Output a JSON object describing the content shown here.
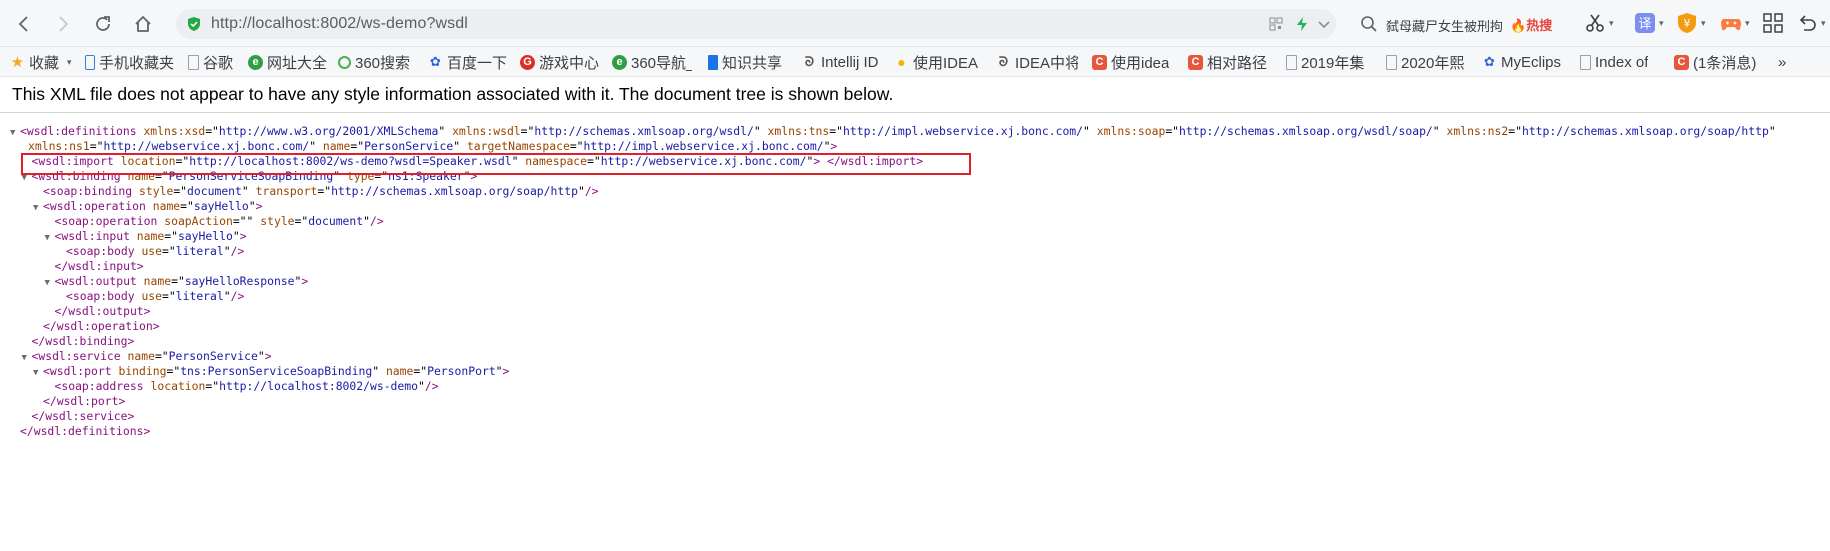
{
  "browser": {
    "url": "http://localhost:8002/ws-demo?wsdl",
    "search_hot_text": "弑母藏尸女生被刑拘",
    "search_hot_badge": "热搜"
  },
  "bookmarks": [
    {
      "label": "收藏",
      "icon": "star-icon",
      "color": "#f5a623"
    },
    {
      "label": "手机收藏夹",
      "icon": "phone-icon",
      "color": "#3a7bd5"
    },
    {
      "label": "谷歌",
      "icon": "page-icon",
      "color": "#9aa0a6"
    },
    {
      "label": "网址大全",
      "icon": "web-icon",
      "color": "#2f9e44"
    },
    {
      "label": "360搜索",
      "icon": "search-360-icon",
      "color": "#4caf50"
    },
    {
      "label": "百度一下",
      "icon": "baidu-paw-icon",
      "color": "#2b63d9"
    },
    {
      "label": "游戏中心",
      "icon": "game-icon",
      "color": "#d93025"
    },
    {
      "label": "360导航_",
      "icon": "nav-360-icon",
      "color": "#2f9e44"
    },
    {
      "label": "知识共享",
      "icon": "bookmark-blue-icon",
      "color": "#1a73e8"
    },
    {
      "label": "Intellij ID",
      "icon": "idea-icon",
      "color": "#555555"
    },
    {
      "label": "使用IDEA",
      "icon": "bulb-icon",
      "color": "#f4b400"
    },
    {
      "label": "IDEA中将",
      "icon": "idea-icon",
      "color": "#555555"
    },
    {
      "label": "使用idea",
      "icon": "csdn-icon",
      "color": "#e8553c"
    },
    {
      "label": "相对路径,",
      "icon": "csdn-icon",
      "color": "#e8553c"
    },
    {
      "label": "2019年集",
      "icon": "page-icon",
      "color": "#9aa0a6"
    },
    {
      "label": "2020年熙",
      "icon": "page-icon",
      "color": "#9aa0a6"
    },
    {
      "label": "MyEclips",
      "icon": "baidu-paw-icon",
      "color": "#2b63d9"
    },
    {
      "label": "Index of",
      "icon": "page-icon",
      "color": "#9aa0a6"
    },
    {
      "label": "(1条消息)",
      "icon": "csdn-icon",
      "color": "#e8553c"
    }
  ],
  "bookmarks_more": "»",
  "page": {
    "info": "This XML file does not appear to have any style information associated with it. The document tree is shown below."
  },
  "xml": {
    "definitions_open": {
      "tag": "wsdl:definitions",
      "attrs": [
        {
          "n": "xmlns:xsd",
          "v": "http://www.w3.org/2001/XMLSchema"
        },
        {
          "n": "xmlns:wsdl",
          "v": "http://schemas.xmlsoap.org/wsdl/"
        },
        {
          "n": "xmlns:tns",
          "v": "http://impl.webservice.xj.bonc.com/"
        },
        {
          "n": "xmlns:soap",
          "v": "http://schemas.xmlsoap.org/wsdl/soap/"
        },
        {
          "n": "xmlns:ns2",
          "v": "http://schemas.xmlsoap.org/soap/http"
        }
      ]
    },
    "definitions_cont": [
      {
        "n": "xmlns:ns1",
        "v": "http://webservice.xj.bonc.com/"
      },
      {
        "n": "name",
        "v": "PersonService"
      },
      {
        "n": "targetNamespace",
        "v": "http://impl.webservice.xj.bonc.com/"
      }
    ],
    "import": {
      "tag": "wsdl:import",
      "attrs": [
        {
          "n": "location",
          "v": "http://localhost:8002/ws-demo?wsdl=Speaker.wsdl"
        },
        {
          "n": "namespace",
          "v": "http://webservice.xj.bonc.com/"
        }
      ],
      "close": "wsdl:import"
    },
    "binding": {
      "tag": "wsdl:binding",
      "attrs": [
        {
          "n": "name",
          "v": "PersonServiceSoapBinding"
        },
        {
          "n": "type",
          "v": "ns1:Speaker"
        }
      ]
    },
    "soap_binding": {
      "tag": "soap:binding",
      "attrs": [
        {
          "n": "style",
          "v": "document"
        },
        {
          "n": "transport",
          "v": "http://schemas.xmlsoap.org/soap/http"
        }
      ]
    },
    "operation": {
      "tag": "wsdl:operation",
      "attrs": [
        {
          "n": "name",
          "v": "sayHello"
        }
      ]
    },
    "soap_operation": {
      "tag": "soap:operation",
      "attrs": [
        {
          "n": "soapAction",
          "v": ""
        },
        {
          "n": "style",
          "v": "document"
        }
      ]
    },
    "input": {
      "tag": "wsdl:input",
      "attrs": [
        {
          "n": "name",
          "v": "sayHello"
        }
      ]
    },
    "soap_body_1": {
      "tag": "soap:body",
      "attrs": [
        {
          "n": "use",
          "v": "literal"
        }
      ]
    },
    "input_close": "wsdl:input",
    "output": {
      "tag": "wsdl:output",
      "attrs": [
        {
          "n": "name",
          "v": "sayHelloResponse"
        }
      ]
    },
    "soap_body_2": {
      "tag": "soap:body",
      "attrs": [
        {
          "n": "use",
          "v": "literal"
        }
      ]
    },
    "output_close": "wsdl:output",
    "operation_close": "wsdl:operation",
    "binding_close": "wsdl:binding",
    "service": {
      "tag": "wsdl:service",
      "attrs": [
        {
          "n": "name",
          "v": "PersonService"
        }
      ]
    },
    "port": {
      "tag": "wsdl:port",
      "attrs": [
        {
          "n": "binding",
          "v": "tns:PersonServiceSoapBinding"
        },
        {
          "n": "name",
          "v": "PersonPort"
        }
      ]
    },
    "soap_address": {
      "tag": "soap:address",
      "attrs": [
        {
          "n": "location",
          "v": "http://localhost:8002/ws-demo"
        }
      ]
    },
    "port_close": "wsdl:port",
    "service_close": "wsdl:service",
    "definitions_close": "wsdl:definitions"
  }
}
